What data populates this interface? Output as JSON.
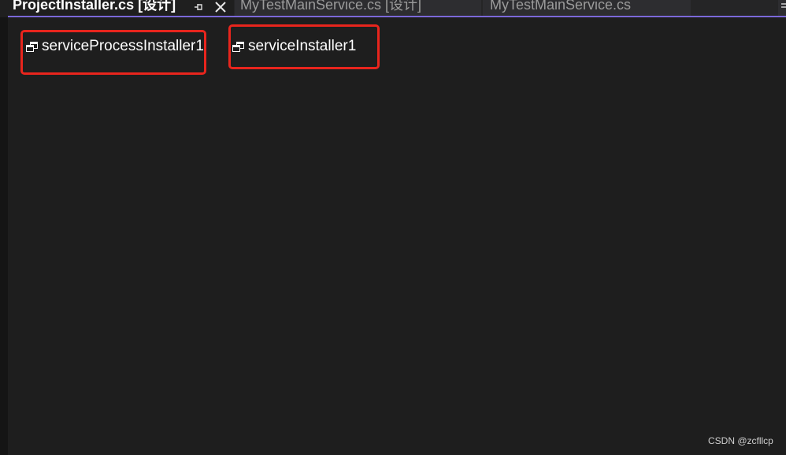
{
  "tabs": [
    {
      "label": "ProjectInstaller.cs [设计]",
      "active": true
    },
    {
      "label": "MyTestMainService.cs [设计]",
      "active": false
    },
    {
      "label": "MyTestMainService.cs",
      "active": false
    }
  ],
  "tab_icons": {
    "pin": "pin-icon",
    "close": "close-icon",
    "overflow": "overflow-menu-icon"
  },
  "designer": {
    "components": [
      {
        "label": "serviceProcessInstaller1",
        "icon": "component-icon",
        "highlighted": true
      },
      {
        "label": "serviceInstaller1",
        "icon": "component-icon",
        "highlighted": true
      }
    ]
  },
  "watermark": "CSDN @zcfllcp",
  "colors": {
    "background": "#1e1e1e",
    "tab_strip": "#2d2d30",
    "accent": "#7b68d9",
    "highlight_border": "#e8251d",
    "active_tab_text": "#ffffff",
    "inactive_tab_text": "#9b9b9b"
  }
}
